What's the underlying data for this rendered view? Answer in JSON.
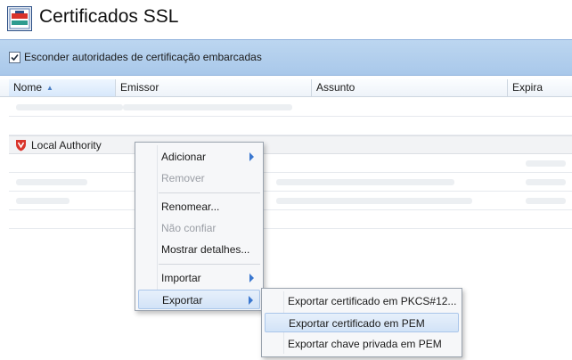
{
  "window": {
    "title": "Certificados SSL"
  },
  "toolbar": {
    "hide_embedded_label": "Esconder autoridades de certificação embarcadas",
    "hide_embedded_checked": true
  },
  "table": {
    "columns": [
      "Nome",
      "Emissor",
      "Assunto",
      "Expira"
    ],
    "sorted_column": "Nome",
    "group_label": "Local Authority"
  },
  "context_menu": {
    "items": [
      {
        "label": "Adicionar",
        "enabled": true,
        "submenu": true
      },
      {
        "label": "Remover",
        "enabled": false
      },
      {
        "label": "Renomear...",
        "enabled": true
      },
      {
        "label": "Não confiar",
        "enabled": false
      },
      {
        "label": "Mostrar detalhes...",
        "enabled": true
      },
      {
        "label": "Importar",
        "enabled": true,
        "submenu": true
      },
      {
        "label": "Exportar",
        "enabled": true,
        "submenu": true,
        "highlighted": true
      }
    ]
  },
  "export_submenu": {
    "items": [
      {
        "label": "Exportar certificado em PKCS#12..."
      },
      {
        "label": "Exportar certificado em PEM",
        "highlighted": true
      },
      {
        "label": "Exportar chave privada em PEM"
      }
    ]
  },
  "colors": {
    "accent": "#3b78d0",
    "toolbar": "#b3cfee",
    "shield": "#d9342b"
  }
}
